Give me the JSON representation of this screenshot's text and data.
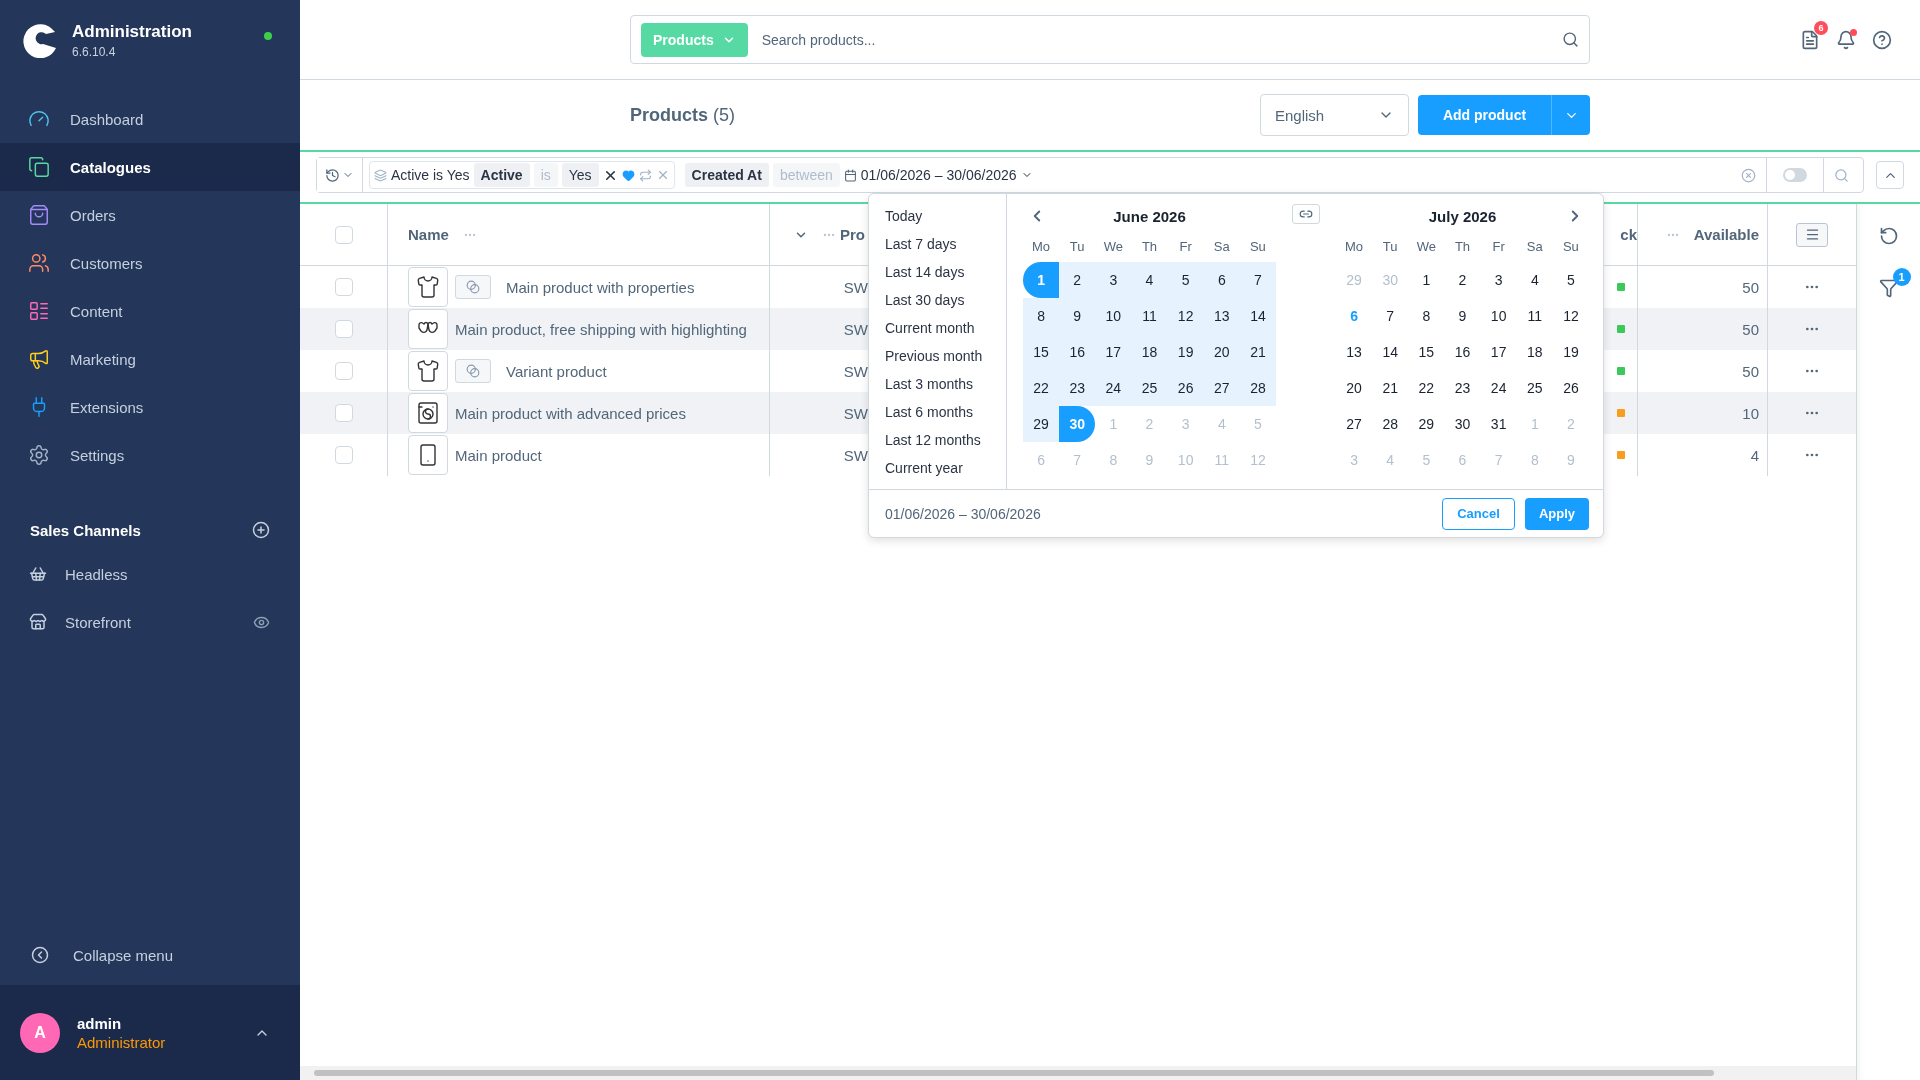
{
  "sidebar": {
    "app_title": "Administration",
    "version": "6.6.10.4",
    "online": true,
    "nav": [
      {
        "label": "Dashboard",
        "selected": false,
        "color": "#4fc1e9"
      },
      {
        "label": "Catalogues",
        "selected": true,
        "color": "#57d9a3"
      },
      {
        "label": "Orders",
        "selected": false,
        "color": "#a38bf8"
      },
      {
        "label": "Customers",
        "selected": false,
        "color": "#ff8c66"
      },
      {
        "label": "Content",
        "selected": false,
        "color": "#ff6ab8"
      },
      {
        "label": "Marketing",
        "selected": false,
        "color": "#ffd11a"
      },
      {
        "label": "Extensions",
        "selected": false,
        "color": "#189eff"
      },
      {
        "label": "Settings",
        "selected": false,
        "color": "#a2b3c6"
      }
    ],
    "sales_channels": {
      "title": "Sales Channels",
      "items": [
        {
          "label": "Headless",
          "has_eye": false
        },
        {
          "label": "Storefront",
          "has_eye": true
        }
      ]
    },
    "collapse_label": "Collapse menu",
    "user": {
      "initial": "A",
      "name": "admin",
      "role": "Administrator"
    }
  },
  "header": {
    "search_type": "Products",
    "search_placeholder": "Search products...",
    "notification_count": "6",
    "bell_unread": true
  },
  "page": {
    "title": "Products",
    "count": "(5)",
    "language": "English",
    "add_button": "Add product"
  },
  "filter_bar": {
    "filters": [
      {
        "kind": "boolean",
        "summary": "Active is Yes",
        "field": "Active",
        "operator": "is",
        "value": "Yes"
      },
      {
        "kind": "date",
        "field": "Created At",
        "operator": "between",
        "value": "01/06/2026 – 30/06/2026"
      }
    ],
    "toggle_on": false
  },
  "table": {
    "all_selected": false,
    "name_header": "Name",
    "column_3_header": "Pro",
    "column_4_header": "ck",
    "available_header": "Available",
    "rows": [
      {
        "selected": false,
        "variant": true,
        "name": "Main product with properties",
        "column_3": "SW",
        "color": "#3cc85a",
        "available": "50"
      },
      {
        "selected": false,
        "variant": false,
        "name": "Main product, free shipping with highlighting",
        "column_3": "SW",
        "color": "#3cc85a",
        "available": "50"
      },
      {
        "selected": false,
        "variant": true,
        "name": "Variant product",
        "column_3": "SW",
        "color": "#3cc85a",
        "available": "50"
      },
      {
        "selected": false,
        "variant": false,
        "name": "Main product with advanced prices",
        "column_3": "SW",
        "color": "#f89e1c",
        "available": "10"
      },
      {
        "selected": false,
        "variant": false,
        "name": "Main product",
        "column_3": "SW",
        "color": "#f89e1c",
        "available": "4"
      }
    ]
  },
  "right_panel": {
    "filter_count": "1"
  },
  "date_picker": {
    "presets": [
      "Today",
      "Last 7 days",
      "Last 14 days",
      "Last 30 days",
      "Current month",
      "Previous month",
      "Last 3 months",
      "Last 6 months",
      "Last 12 months",
      "Current year"
    ],
    "months": [
      {
        "title": "June 2026",
        "show_prev": true,
        "show_next": false,
        "weekdays": [
          "Mo",
          "Tu",
          "We",
          "Th",
          "Fr",
          "Sa",
          "Su"
        ],
        "weeks": [
          [
            {
              "day": "1",
              "kind": "start"
            },
            {
              "day": "2",
              "kind": "range"
            },
            {
              "day": "3",
              "kind": "range"
            },
            {
              "day": "4",
              "kind": "range"
            },
            {
              "day": "5",
              "kind": "range"
            },
            {
              "day": "6",
              "kind": "range"
            },
            {
              "day": "7",
              "kind": "range"
            }
          ],
          [
            {
              "day": "8",
              "kind": "range"
            },
            {
              "day": "9",
              "kind": "range"
            },
            {
              "day": "10",
              "kind": "range"
            },
            {
              "day": "11",
              "kind": "range"
            },
            {
              "day": "12",
              "kind": "range"
            },
            {
              "day": "13",
              "kind": "range"
            },
            {
              "day": "14",
              "kind": "range"
            }
          ],
          [
            {
              "day": "15",
              "kind": "range"
            },
            {
              "day": "16",
              "kind": "range"
            },
            {
              "day": "17",
              "kind": "range"
            },
            {
              "day": "18",
              "kind": "range"
            },
            {
              "day": "19",
              "kind": "range"
            },
            {
              "day": "20",
              "kind": "range"
            },
            {
              "day": "21",
              "kind": "range"
            }
          ],
          [
            {
              "day": "22",
              "kind": "range"
            },
            {
              "day": "23",
              "kind": "range"
            },
            {
              "day": "24",
              "kind": "range"
            },
            {
              "day": "25",
              "kind": "range"
            },
            {
              "day": "26",
              "kind": "range"
            },
            {
              "day": "27",
              "kind": "range"
            },
            {
              "day": "28",
              "kind": "range"
            }
          ],
          [
            {
              "day": "29",
              "kind": "range"
            },
            {
              "day": "30",
              "kind": "end"
            },
            {
              "day": "1",
              "kind": "outside"
            },
            {
              "day": "2",
              "kind": "outside"
            },
            {
              "day": "3",
              "kind": "outside"
            },
            {
              "day": "4",
              "kind": "outside"
            },
            {
              "day": "5",
              "kind": "outside"
            }
          ],
          [
            {
              "day": "6",
              "kind": "outside"
            },
            {
              "day": "7",
              "kind": "outside"
            },
            {
              "day": "8",
              "kind": "outside"
            },
            {
              "day": "9",
              "kind": "outside"
            },
            {
              "day": "10",
              "kind": "outside"
            },
            {
              "day": "11",
              "kind": "outside"
            },
            {
              "day": "12",
              "kind": "outside"
            }
          ]
        ]
      },
      {
        "title": "July 2026",
        "show_prev": false,
        "show_next": true,
        "weekdays": [
          "Mo",
          "Tu",
          "We",
          "Th",
          "Fr",
          "Sa",
          "Su"
        ],
        "weeks": [
          [
            {
              "day": "29",
              "kind": "outside"
            },
            {
              "day": "30",
              "kind": "outside"
            },
            {
              "day": "1",
              "kind": "normal"
            },
            {
              "day": "2",
              "kind": "normal"
            },
            {
              "day": "3",
              "kind": "normal"
            },
            {
              "day": "4",
              "kind": "normal"
            },
            {
              "day": "5",
              "kind": "normal"
            }
          ],
          [
            {
              "day": "6",
              "kind": "today"
            },
            {
              "day": "7",
              "kind": "normal"
            },
            {
              "day": "8",
              "kind": "normal"
            },
            {
              "day": "9",
              "kind": "normal"
            },
            {
              "day": "10",
              "kind": "normal"
            },
            {
              "day": "11",
              "kind": "normal"
            },
            {
              "day": "12",
              "kind": "normal"
            }
          ],
          [
            {
              "day": "13",
              "kind": "normal"
            },
            {
              "day": "14",
              "kind": "normal"
            },
            {
              "day": "15",
              "kind": "normal"
            },
            {
              "day": "16",
              "kind": "normal"
            },
            {
              "day": "17",
              "kind": "normal"
            },
            {
              "day": "18",
              "kind": "normal"
            },
            {
              "day": "19",
              "kind": "normal"
            }
          ],
          [
            {
              "day": "20",
              "kind": "normal"
            },
            {
              "day": "21",
              "kind": "normal"
            },
            {
              "day": "22",
              "kind": "normal"
            },
            {
              "day": "23",
              "kind": "normal"
            },
            {
              "day": "24",
              "kind": "normal"
            },
            {
              "day": "25",
              "kind": "normal"
            },
            {
              "day": "26",
              "kind": "normal"
            }
          ],
          [
            {
              "day": "27",
              "kind": "normal"
            },
            {
              "day": "28",
              "kind": "normal"
            },
            {
              "day": "29",
              "kind": "normal"
            },
            {
              "day": "30",
              "kind": "normal"
            },
            {
              "day": "31",
              "kind": "normal"
            },
            {
              "day": "1",
              "kind": "outside"
            },
            {
              "day": "2",
              "kind": "outside"
            }
          ],
          [
            {
              "day": "3",
              "kind": "outside"
            },
            {
              "day": "4",
              "kind": "outside"
            },
            {
              "day": "5",
              "kind": "outside"
            },
            {
              "day": "6",
              "kind": "outside"
            },
            {
              "day": "7",
              "kind": "outside"
            },
            {
              "day": "8",
              "kind": "outside"
            },
            {
              "day": "9",
              "kind": "outside"
            }
          ]
        ]
      }
    ],
    "range_text": "01/06/2026 – 30/06/2026",
    "cancel": "Cancel",
    "apply": "Apply"
  }
}
